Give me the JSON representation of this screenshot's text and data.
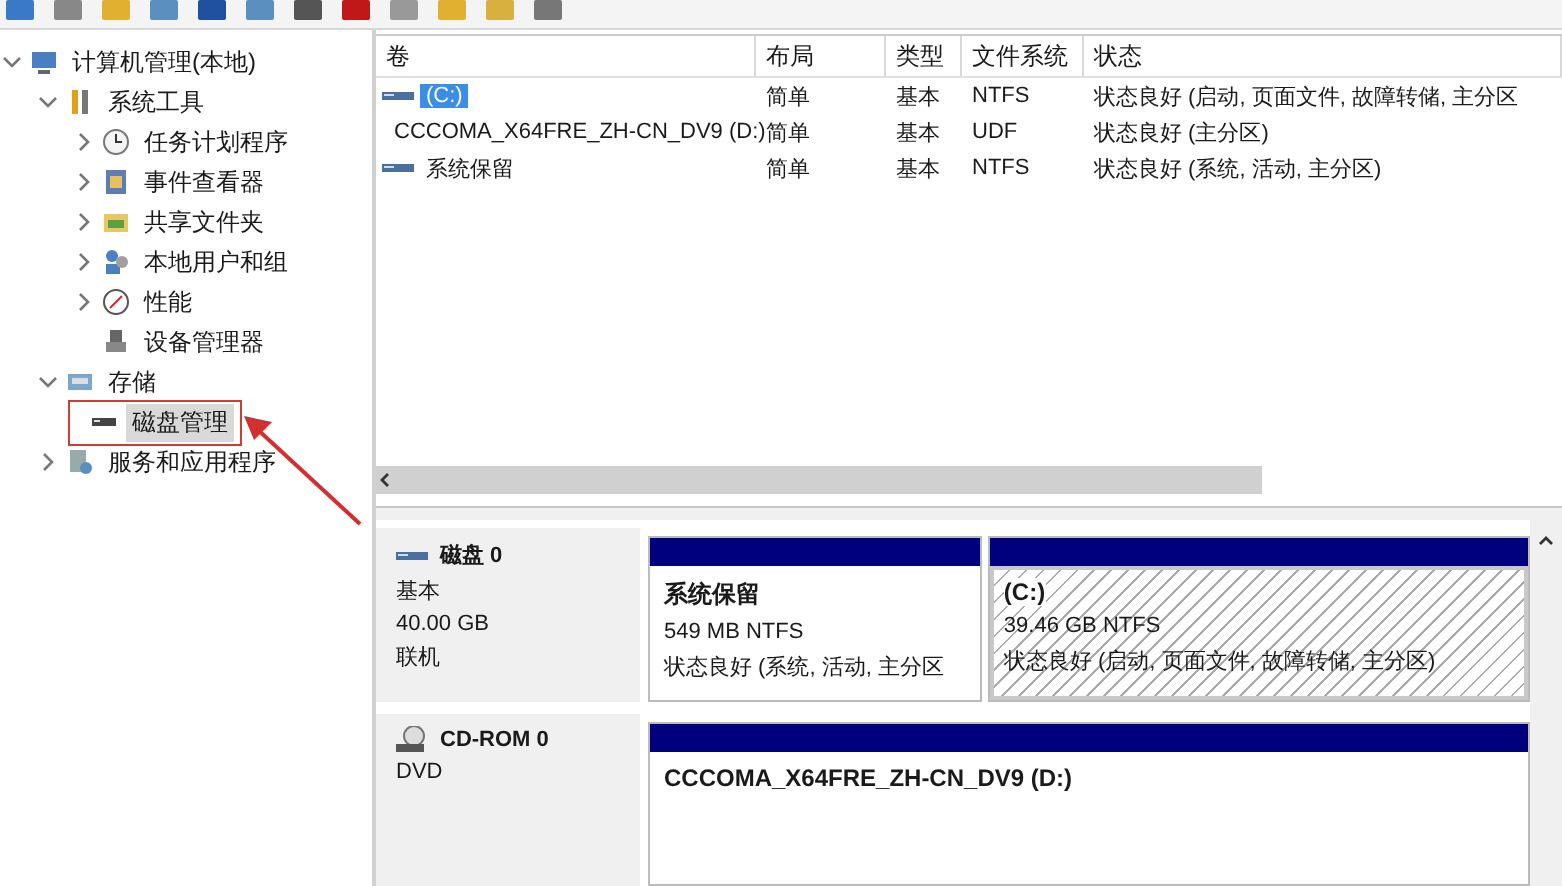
{
  "tree": [
    {
      "label": "计算机管理(本地)",
      "expanded": true,
      "selected": false,
      "children": [
        {
          "label": "系统工具",
          "expanded": true,
          "selected": false,
          "children": [
            {
              "label": "任务计划程序",
              "expanded": false,
              "selected": false
            },
            {
              "label": "事件查看器",
              "expanded": false,
              "selected": false
            },
            {
              "label": "共享文件夹",
              "expanded": false,
              "selected": false
            },
            {
              "label": "本地用户和组",
              "expanded": false,
              "selected": false
            },
            {
              "label": "性能",
              "expanded": false,
              "selected": false
            },
            {
              "label": "设备管理器",
              "selected": false
            }
          ]
        },
        {
          "label": "存储",
          "expanded": true,
          "selected": false,
          "children": [
            {
              "label": "磁盘管理",
              "selected": true
            }
          ]
        },
        {
          "label": "服务和应用程序",
          "expanded": false,
          "selected": false
        }
      ]
    }
  ],
  "volumes": {
    "columns": [
      "卷",
      "布局",
      "类型",
      "文件系统",
      "状态"
    ],
    "rows": [
      {
        "kind": "disk",
        "name": "(C:)",
        "selected": true,
        "layout": "简单",
        "type": "基本",
        "fs": "NTFS",
        "status": "状态良好 (启动, 页面文件, 故障转储, 主分区"
      },
      {
        "kind": "cdrom",
        "name": "CCCOMA_X64FRE_ZH-CN_DV9 (D:)",
        "selected": false,
        "layout": "简单",
        "type": "基本",
        "fs": "UDF",
        "status": "状态良好 (主分区)"
      },
      {
        "kind": "disk",
        "name": "系统保留",
        "selected": false,
        "layout": "简单",
        "type": "基本",
        "fs": "NTFS",
        "status": "状态良好 (系统, 活动, 主分区)"
      }
    ]
  },
  "disks": [
    {
      "kind": "disk",
      "name": "磁盘 0",
      "lines": [
        "基本",
        "40.00 GB",
        "联机"
      ],
      "partitions": [
        {
          "name": "系统保留",
          "selected": false,
          "lines": [
            "549 MB NTFS",
            "状态良好 (系统, 活动, 主分区"
          ]
        },
        {
          "name": "(C:)",
          "selected": true,
          "lines": [
            "39.46 GB NTFS",
            "状态良好 (启动, 页面文件, 故障转储, 主分区)"
          ]
        }
      ]
    },
    {
      "kind": "cdrom",
      "name": "CD-ROM 0",
      "lines": [
        "DVD"
      ],
      "partitions": [
        {
          "name": "CCCOMA_X64FRE_ZH-CN_DV9  (D:)",
          "selected": false
        }
      ]
    }
  ]
}
